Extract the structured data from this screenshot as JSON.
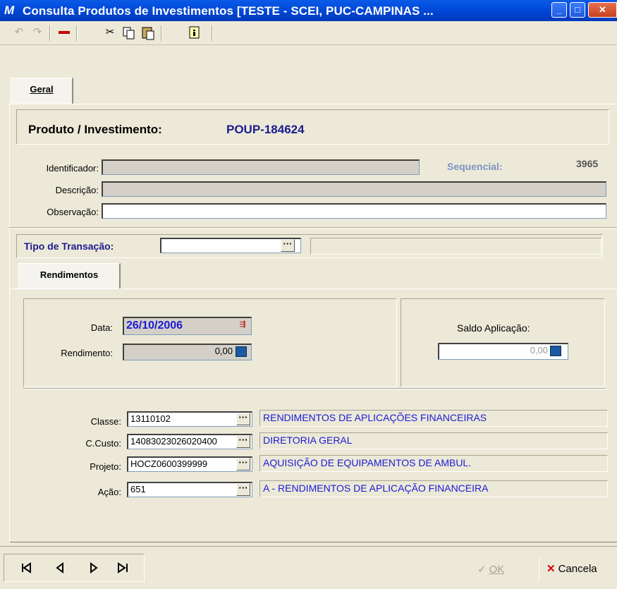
{
  "window": {
    "title": "Consulta Produtos de Investimentos [TESTE - SCEI, PUC-CAMPINAS ...",
    "logo_glyph": "M"
  },
  "toolbar": {
    "icons": [
      "undo-icon",
      "redo-icon",
      "delete-icon",
      "cut-icon",
      "copy-icon",
      "paste-icon",
      "info-icon"
    ]
  },
  "tabs": {
    "main": "Geral",
    "sub": "Rendimentos"
  },
  "header": {
    "label": "Produto / Investimento:",
    "value": "POUP-184624"
  },
  "fields": {
    "identificador_label": "Identificador:",
    "identificador_value": "",
    "sequencial_label": "Sequencial:",
    "sequencial_value": "3965",
    "descricao_label": "Descrição:",
    "descricao_value": "",
    "observacao_label": "Observação:",
    "observacao_value": "",
    "tipo_label": "Tipo de Transação:",
    "tipo_value": "",
    "tipo_desc": ""
  },
  "rendimentos": {
    "data_label": "Data:",
    "data_value": "26/10/2006",
    "rendimento_label": "Rendimento:",
    "rendimento_value": "0,00",
    "saldo_label": "Saldo Aplicação:",
    "saldo_value": "0,00"
  },
  "accounting": {
    "classe_label": "Classe:",
    "classe_value": "13110102",
    "classe_desc": "RENDIMENTOS DE APLICAÇÕES FINANCEIRAS",
    "ccusto_label": "C.Custo:",
    "ccusto_value": "14083023026020400",
    "ccusto_desc": "DIRETORIA GERAL",
    "projeto_label": "Projeto:",
    "projeto_value": "HOCZ0600399999",
    "projeto_desc": "AQUISIÇÃO DE EQUIPAMENTOS DE AMBUL.",
    "acao_label": "Ação:",
    "acao_value": "651",
    "acao_desc": "A - RENDIMENTOS DE APLICAÇÃO FINANCEIRA"
  },
  "footer": {
    "ok_label": "OK",
    "cancel_label": "Cancela"
  },
  "colors": {
    "title_bar": "#0054e3",
    "label_blue": "#1b1b8f",
    "value_blue": "#1b1bd6",
    "sequencial_gray_blue": "#7d93c6",
    "cancel_red": "#d40000"
  }
}
